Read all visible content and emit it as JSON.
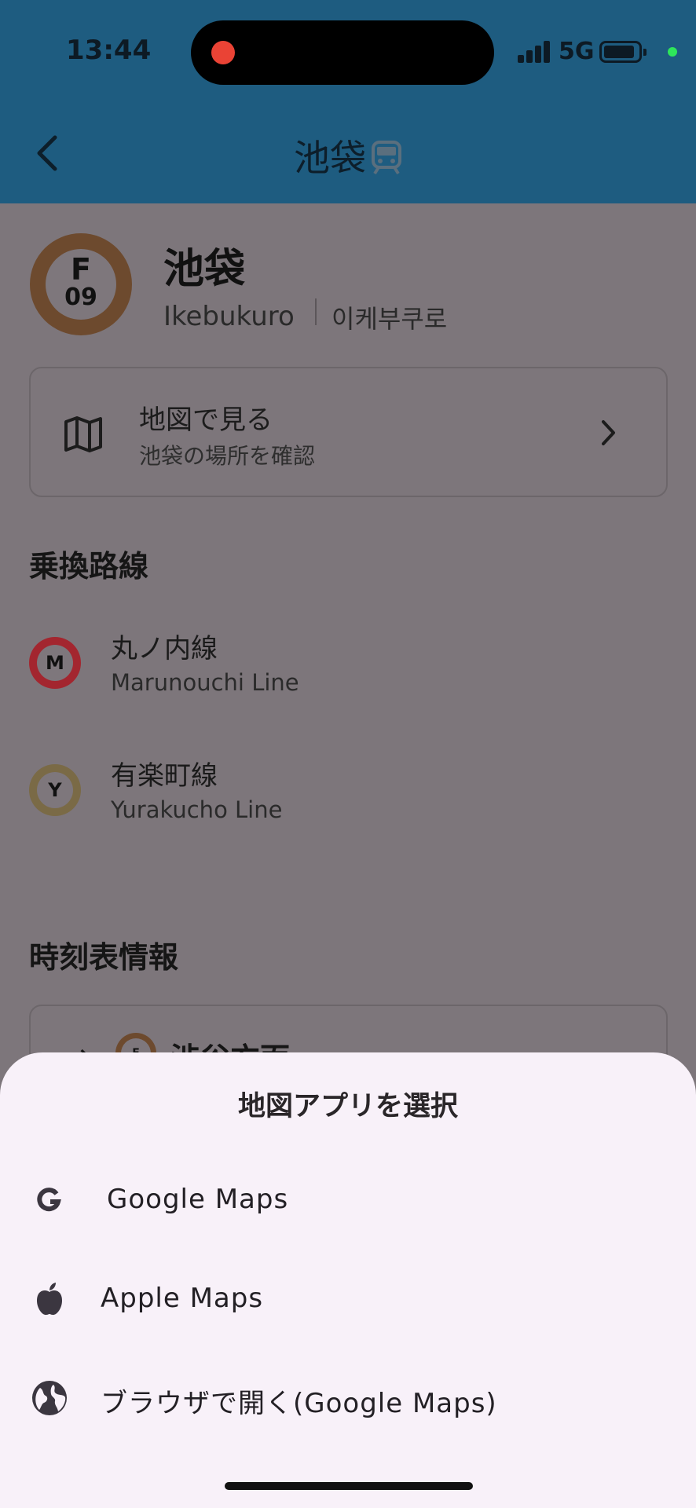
{
  "status_bar": {
    "time": "13:44",
    "network": "5G"
  },
  "app_bar": {
    "title": "池袋"
  },
  "station": {
    "line_code": "F",
    "number": "09",
    "name_jp": "池袋",
    "name_en": "Ikebukuro",
    "name_ko": "이케부쿠로",
    "badge_color": "#6d4a2e"
  },
  "map_card": {
    "title": "地図で見る",
    "subtitle": "池袋の場所を確認"
  },
  "transfer": {
    "heading": "乗換路線",
    "lines": [
      {
        "code": "M",
        "name_jp": "丸ノ内線",
        "name_en": "Marunouchi Line",
        "color": "#a3262f"
      },
      {
        "code": "Y",
        "name_jp": "有楽町線",
        "name_en": "Yurakucho Line",
        "color": "#7a6a46"
      }
    ]
  },
  "timetable": {
    "heading": "時刻表情報",
    "first_direction": {
      "code": "F",
      "label": "渋谷方面"
    }
  },
  "sheet": {
    "title": "地図アプリを選択",
    "options": [
      {
        "label": "Google Maps",
        "icon": "google-icon"
      },
      {
        "label": "Apple Maps",
        "icon": "apple-icon"
      },
      {
        "label": "ブラウザで開く(Google Maps)",
        "icon": "globe-icon"
      }
    ]
  }
}
